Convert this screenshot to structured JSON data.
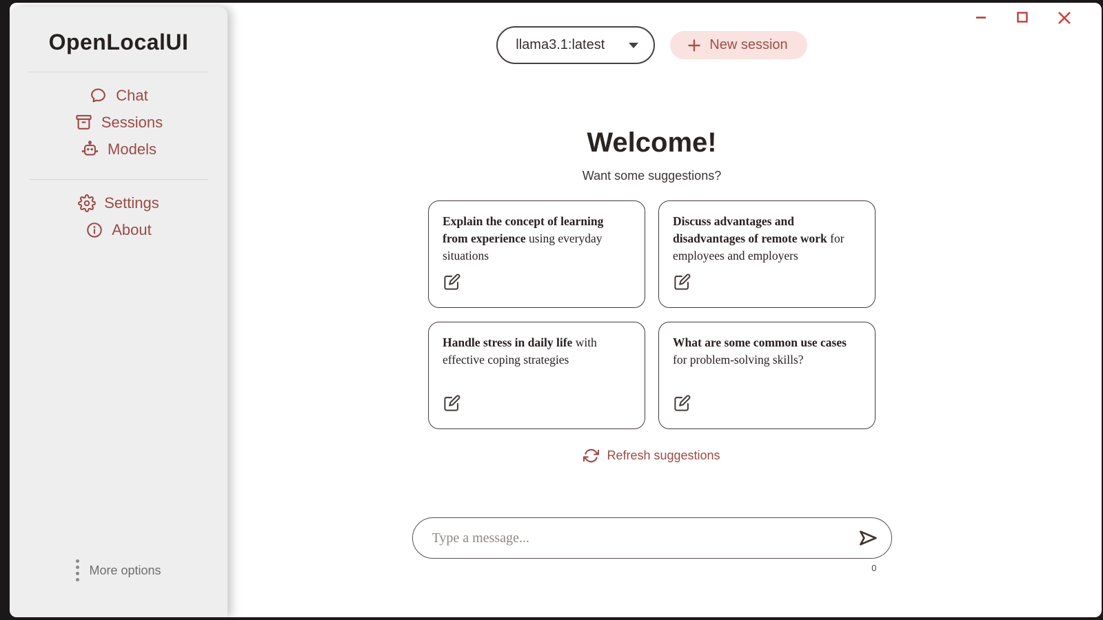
{
  "app": {
    "title": "OpenLocalUI"
  },
  "colors": {
    "accent_maroon": "#9a4b46",
    "new_session_bg": "#f9e2df",
    "new_session_text": "#9e4f49",
    "sidebar_bg": "#efeeee",
    "window_frame": "#1b181a",
    "control_red": "#c0403a",
    "text_dark": "#262120",
    "muted_gray": "#6e6e6e"
  },
  "sidebar": {
    "logo": "OpenLocalUI",
    "nav": [
      {
        "icon": "chat-bubble-icon",
        "label": "Chat"
      },
      {
        "icon": "archive-icon",
        "label": "Sessions"
      },
      {
        "icon": "robot-icon",
        "label": "Models"
      }
    ],
    "secondary_nav": [
      {
        "icon": "gear-icon",
        "label": "Settings"
      },
      {
        "icon": "info-icon",
        "label": "About"
      }
    ],
    "more_options_label": "More options"
  },
  "header": {
    "model_selector": {
      "value": "llama3.1:latest"
    },
    "new_session_label": "New session"
  },
  "main": {
    "welcome_title": "Welcome!",
    "welcome_subtitle": "Want some suggestions?",
    "suggestions": [
      {
        "bold": "Explain the concept of learning from experience",
        "rest": " using everyday situations"
      },
      {
        "bold": "Discuss advantages and disadvantages of remote work",
        "rest": " for employees and employers"
      },
      {
        "bold": "Handle stress in daily life",
        "rest": " with effective coping strategies"
      },
      {
        "bold": "What are some common use cases",
        "rest": " for problem-solving skills?"
      }
    ],
    "refresh_label": "Refresh suggestions"
  },
  "composer": {
    "placeholder": "Type a message...",
    "char_count": "0"
  }
}
